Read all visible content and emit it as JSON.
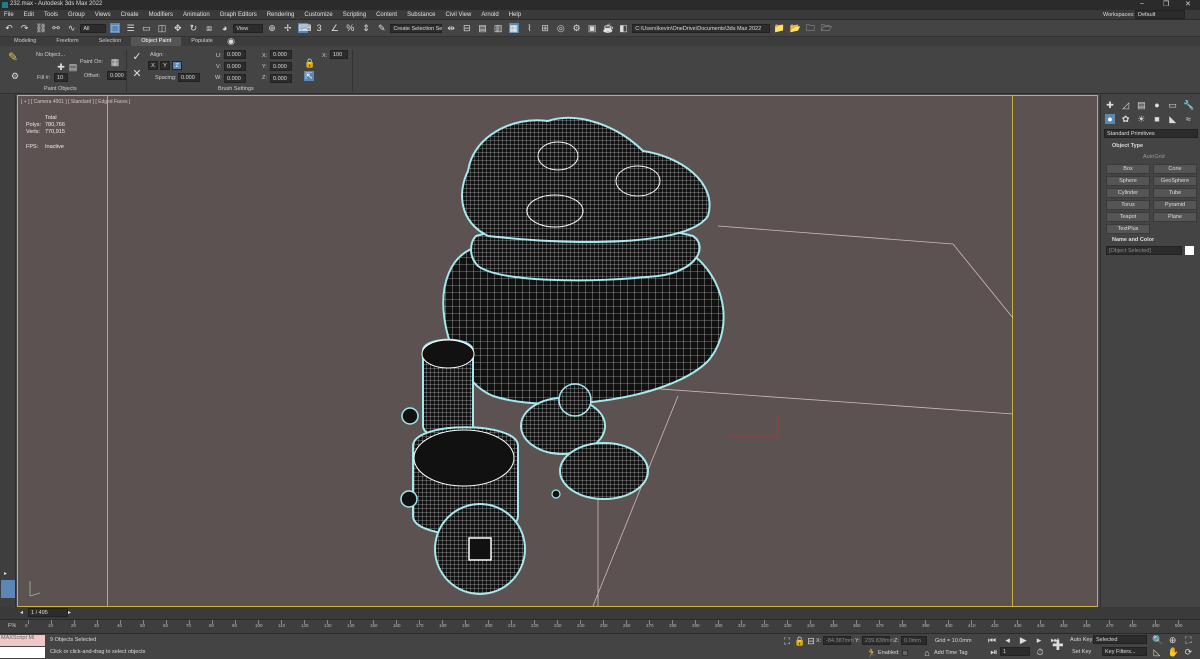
{
  "window": {
    "title": "232.max - Autodesk 3ds Max 2022",
    "workspaces_label": "Workspaces:",
    "workspace_value": "Default"
  },
  "menu": [
    "File",
    "Edit",
    "Tools",
    "Group",
    "Views",
    "Create",
    "Modifiers",
    "Animation",
    "Graph Editors",
    "Rendering",
    "Customize",
    "Scripting",
    "Content",
    "Substance",
    "Civil View",
    "Arnold",
    "Help"
  ],
  "toolbar": {
    "selection_filter": "All",
    "ref_coord": "View",
    "named_selection": "Create Selection Se",
    "project_path": "C:\\Users\\kevin\\OneDrive\\Documents\\3ds Max 2022"
  },
  "ribbon": {
    "tabs": [
      "Modeling",
      "Freeform",
      "Selection",
      "Object Paint",
      "Populate"
    ],
    "active_tab": "Object Paint",
    "no_object": "No Object...",
    "paint_on": "Paint On:",
    "fill_label": "Fill #:",
    "fill_value": "10",
    "offset_label": "Offset:",
    "offset_value": "0.000",
    "align_label": "Align:",
    "axes": [
      "X",
      "Y",
      "Z"
    ],
    "spacing_label": "Spacing:",
    "spacing_value": "0.000",
    "u_label": "U:",
    "v_label": "V:",
    "w_label": "W:",
    "x_label": "X:",
    "y_label": "Y:",
    "z_label": "Z:",
    "zero_value": "0.000",
    "scale_label": "X:",
    "scale_value": "100",
    "group_object_paint": "Paint Objects",
    "group_brush_settings": "Brush Settings"
  },
  "viewport": {
    "label": "[ + ] [ Camera 4001 ] [ Standard ] [ Edged Faces ]",
    "stats_total": "Total",
    "polys_label": "Polys:",
    "polys_value": "780,766",
    "verts_label": "Verts:",
    "verts_value": "770,915",
    "fps_label": "FPS:",
    "fps_value": "Inactive"
  },
  "command_panel": {
    "category": "Standard Primitives",
    "rollout_object_type": "Object Type",
    "autogrid": "AutoGrid",
    "buttons": [
      "Box",
      "Cone",
      "Sphere",
      "GeoSphere",
      "Cylinder",
      "Tube",
      "Torus",
      "Pyramid",
      "Teapot",
      "Plane",
      "TextPlus"
    ],
    "rollout_name_color": "Name and Color",
    "no_selection": "[Object Selected]"
  },
  "timeline": {
    "frame_counter": "1 / 495",
    "ticks": [
      "0",
      "10",
      "20",
      "30",
      "40",
      "50",
      "60",
      "70",
      "80",
      "90",
      "100",
      "110",
      "120",
      "130",
      "140",
      "150",
      "160",
      "170",
      "180",
      "190",
      "200",
      "210",
      "220",
      "230",
      "240",
      "250",
      "260",
      "270",
      "280",
      "290",
      "300",
      "310",
      "320",
      "330",
      "340",
      "350",
      "360",
      "370",
      "380",
      "390",
      "400",
      "410",
      "420",
      "430",
      "440",
      "450",
      "460",
      "470",
      "480",
      "490",
      "500"
    ]
  },
  "status": {
    "maxscript": "MAXScript Mi",
    "selection_count": "9 Objects Selected",
    "prompt": "Click or click-and-drag to select objects",
    "x_label": "X:",
    "x_value": "-84.387mm",
    "y_label": "Y:",
    "y_value": "239.838mm",
    "z_label": "Z:",
    "z_value": "0.0mm",
    "grid": "Grid = 10.0mm",
    "enabled": "Enabled:",
    "add_time_tag": "Add Time Tag",
    "auto_key": "Auto Key",
    "selected_dropdown": "Selected",
    "set_key": "Set Key",
    "key_filters": "Key Filters...",
    "frame_value": "1"
  },
  "colors": {
    "viewport_bg": "#5d5252",
    "viewport_border": "#c9b23a",
    "wire_highlight": "#9fe9ef",
    "accent": "#5b87b5"
  }
}
